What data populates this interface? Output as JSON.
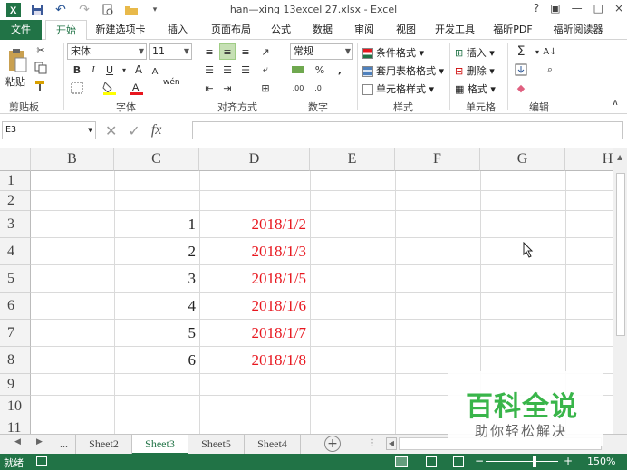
{
  "window": {
    "title": "han—xing 13excel 27.xlsx - Excel",
    "controls": [
      "?",
      "▣",
      "—",
      "□",
      "×"
    ]
  },
  "tabs": [
    {
      "label": "文件"
    },
    {
      "label": "开始"
    },
    {
      "label": "新建选项卡"
    },
    {
      "label": "插入"
    },
    {
      "label": "页面布局"
    },
    {
      "label": "公式"
    },
    {
      "label": "数据"
    },
    {
      "label": "审阅"
    },
    {
      "label": "视图"
    },
    {
      "label": "开发工具"
    },
    {
      "label": "福昕PDF"
    },
    {
      "label": "福昕阅读器"
    }
  ],
  "ribbon": {
    "paste_label": "粘贴",
    "font_name": "宋体",
    "font_size": "11",
    "pinyin_label": "wén",
    "number_format": "常规",
    "styles": {
      "conditional": "条件格式",
      "table": "套用表格格式",
      "cell_style": "单元格样式"
    },
    "cells": {
      "insert": "插入",
      "delete": "删除",
      "format": "格式"
    },
    "groups": {
      "clipboard": "剪贴板",
      "font": "字体",
      "alignment": "对齐方式",
      "number": "数字",
      "styles": "样式",
      "cells": "单元格",
      "editing": "编辑"
    },
    "colors": {
      "accent": "#217346",
      "highlight": "#ffff00",
      "font_color": "#e8161e"
    }
  },
  "formula_bar": {
    "name_box": "E3",
    "fx": "fx",
    "value": ""
  },
  "grid": {
    "columns": [
      "B",
      "C",
      "D",
      "E",
      "F",
      "G",
      "H"
    ],
    "rows": [
      "1",
      "2",
      "3",
      "4",
      "5",
      "6",
      "7",
      "8",
      "9",
      "10",
      "11"
    ],
    "data": [
      {
        "c": "1",
        "d": "2018/1/2"
      },
      {
        "c": "2",
        "d": "2018/1/3"
      },
      {
        "c": "3",
        "d": "2018/1/5"
      },
      {
        "c": "4",
        "d": "2018/1/6"
      },
      {
        "c": "5",
        "d": "2018/1/7"
      },
      {
        "c": "6",
        "d": "2018/1/8"
      }
    ],
    "date_color": "#e8161e"
  },
  "sheets": {
    "ellipsis": "...",
    "tabs": [
      "Sheet2",
      "Sheet3",
      "Sheet5",
      "Sheet4"
    ],
    "active": "Sheet3"
  },
  "status": {
    "ready": "就绪",
    "zoom": "150%"
  },
  "watermark": {
    "line1": "百科全说",
    "line2": "助你轻松解决"
  }
}
